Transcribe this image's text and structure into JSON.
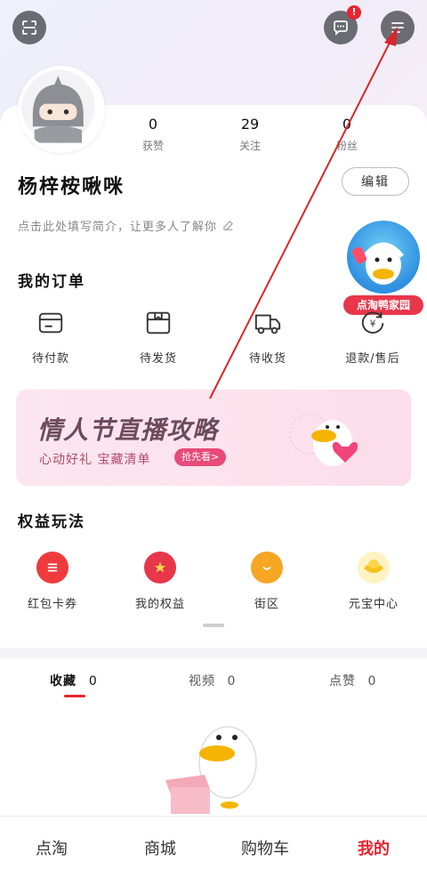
{
  "header": {
    "message_badge": "!",
    "icons": [
      "scan-icon",
      "message-icon",
      "menu-icon"
    ]
  },
  "profile": {
    "username": "杨梓桉啾咪",
    "edit_label": "编辑",
    "bio_placeholder": "点击此处填写简介，让更多人了解你",
    "stats": [
      {
        "value": "0",
        "label": "获赞"
      },
      {
        "value": "29",
        "label": "关注"
      },
      {
        "value": "0",
        "label": "粉丝"
      }
    ]
  },
  "orders": {
    "title": "我的订单",
    "items": [
      {
        "label": "待付款",
        "icon": "wallet-icon"
      },
      {
        "label": "待发货",
        "icon": "box-icon"
      },
      {
        "label": "待收货",
        "icon": "truck-icon"
      },
      {
        "label": "退款/售后",
        "icon": "refund-icon"
      }
    ]
  },
  "floating_badge": {
    "label": "点淘鸭家园"
  },
  "banner": {
    "title": "情人节直播攻略",
    "subtitle": "心动好礼 宝藏清单",
    "cta": "抢先看>"
  },
  "perks": {
    "title": "权益玩法",
    "items": [
      {
        "label": "红包卡券",
        "icon": "coupon-icon",
        "color": "#ef3b3b"
      },
      {
        "label": "我的权益",
        "icon": "medal-icon",
        "color": "#e8364a"
      },
      {
        "label": "街区",
        "icon": "chat-bubble-icon",
        "color": "#f5a623"
      },
      {
        "label": "元宝中心",
        "icon": "ingot-icon",
        "color": "#f7c21a"
      }
    ]
  },
  "content_tabs": [
    {
      "label": "收藏",
      "count": "0",
      "active": true
    },
    {
      "label": "视频",
      "count": "0",
      "active": false
    },
    {
      "label": "点赞",
      "count": "0",
      "active": false
    }
  ],
  "bottom_nav": [
    {
      "label": "点淘",
      "active": false
    },
    {
      "label": "商城",
      "active": false
    },
    {
      "label": "购物车",
      "active": false
    },
    {
      "label": "我的",
      "active": true
    }
  ],
  "colors": {
    "accent": "#e8242f",
    "annotation_arrow": "#d8262c"
  }
}
